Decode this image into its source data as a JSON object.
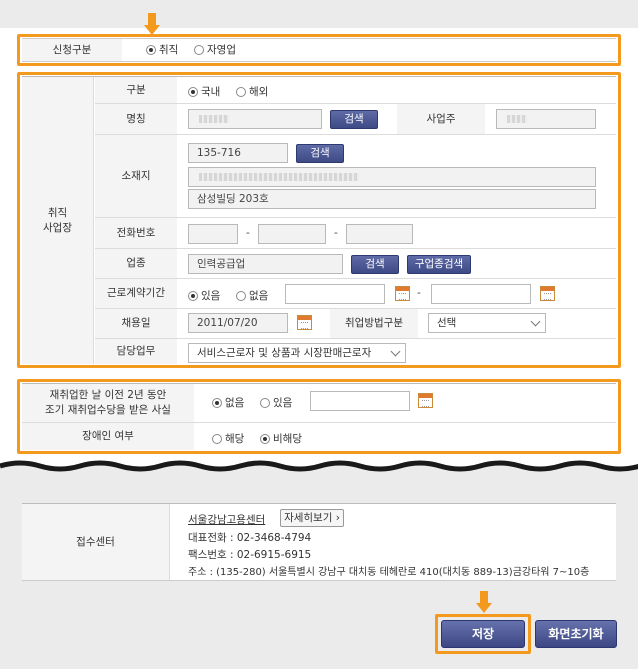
{
  "section1": {
    "label": "신청구분",
    "options": [
      {
        "label": "취직",
        "checked": true
      },
      {
        "label": "자영업",
        "checked": false
      }
    ]
  },
  "workplace": {
    "label": "취직\n사업장",
    "type_label": "구분",
    "type_options": [
      {
        "label": "국내",
        "checked": true
      },
      {
        "label": "해외",
        "checked": false
      }
    ],
    "name_label": "명칭",
    "search_button": "검색",
    "owner_label": "사업주",
    "address_label": "소재지",
    "postal_code": "135-716",
    "address_search_button": "검색",
    "address_detail": "삼성빌딩 203호",
    "phone_label": "전화번호",
    "industry_label": "업종",
    "industry_value": "인력공급업",
    "industry_search_button": "검색",
    "job_search_button": "구업종검색",
    "contract_label": "근로계약기간",
    "contract_options": [
      {
        "label": "있음",
        "checked": true
      },
      {
        "label": "없음",
        "checked": false
      }
    ],
    "hire_date_label": "채용일",
    "hire_date_value": "2011/07/20",
    "method_label": "취업방법구분",
    "method_value": "선택",
    "duty_label": "담당업무",
    "duty_value": "서비스근로자 및 상품과 시장판매근로자"
  },
  "section3": {
    "reemploy_label": "재취업한 날 이전 2년 동안\n조기 재취업수당을 받은 사실",
    "reemploy_options": [
      {
        "label": "없음",
        "checked": true
      },
      {
        "label": "있음",
        "checked": false
      }
    ],
    "disability_label": "장애인 여부",
    "disability_options": [
      {
        "label": "해당",
        "checked": false
      },
      {
        "label": "비해당",
        "checked": true
      }
    ]
  },
  "center": {
    "label": "접수센터",
    "name": "서울강남고용센터",
    "detail_button": "자세히보기",
    "phone": "대표전화 : 02-3468-4794",
    "fax": "팩스번호 : 02-6915-6915",
    "address": "주소 : (135-280) 서울특별시 강남구 대치동 테헤란로 410(대치동 889-13)금강타워 7~10층"
  },
  "actions": {
    "save": "저장",
    "reset": "화면초기화"
  },
  "colors": {
    "highlight": "#f39a1e",
    "button": "#48538e"
  }
}
